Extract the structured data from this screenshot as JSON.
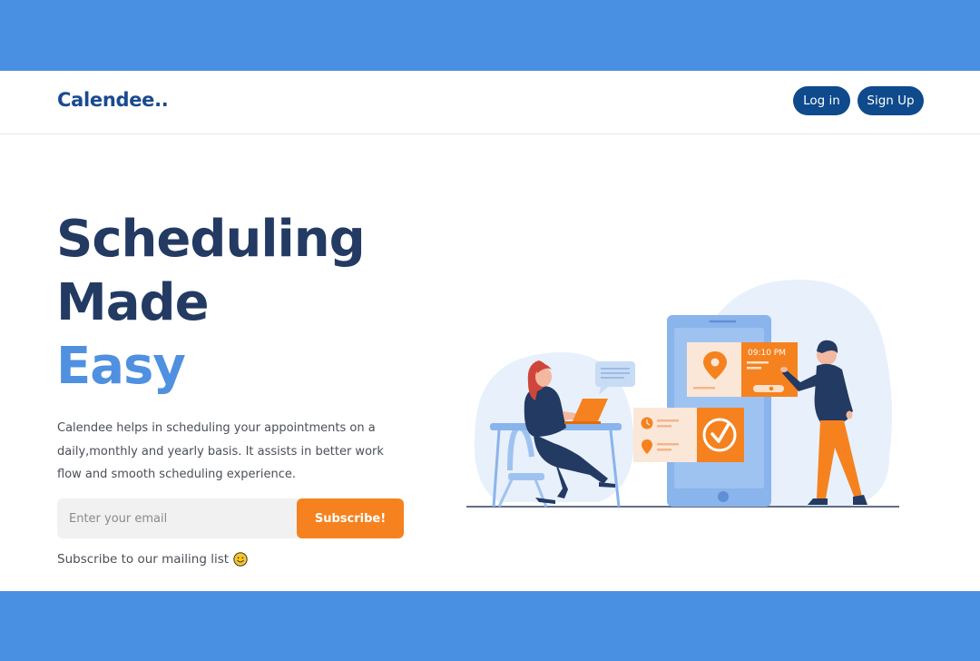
{
  "header": {
    "logo": "Calendee..",
    "login_label": "Log in",
    "signup_label": "Sign Up"
  },
  "hero": {
    "title_line1": "Scheduling",
    "title_line2": "Made",
    "title_line3": "Easy",
    "description": "Calendee helps in scheduling your appointments on a daily,monthly and yearly basis. It assists in better work flow and smooth scheduling experience.",
    "email_placeholder": "Enter your email",
    "subscribe_label": "Subscribe!",
    "mailing_text": "Subscribe to our mailing list"
  },
  "illustration": {
    "time_label": "09:10 PM",
    "icons": [
      "location-pin-icon",
      "checkmark-icon",
      "clock-icon",
      "chat-bubble-icon"
    ]
  },
  "colors": {
    "accent_blue": "#4a90e2",
    "navy": "#233a63",
    "button_blue": "#0e4a8c",
    "orange": "#f5821f"
  }
}
